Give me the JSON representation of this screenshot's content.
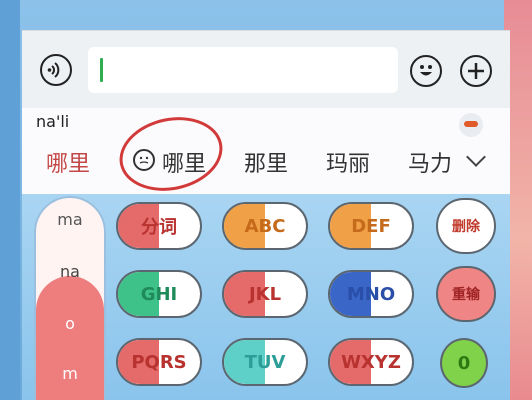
{
  "input": {
    "value": ""
  },
  "candidates": {
    "pinyin": "na'li",
    "items": [
      "哪里",
      "哪里",
      "那里",
      "玛丽",
      "马力"
    ]
  },
  "keyboard": {
    "syllables": [
      "ma",
      "na",
      "o",
      "m"
    ],
    "keys": [
      "分词",
      "ABC",
      "DEF",
      "GHI",
      "JKL",
      "MNO",
      "PQRS",
      "TUV",
      "WXYZ"
    ],
    "side": {
      "delete": "删除",
      "reenter": "重输",
      "zero": "0"
    }
  },
  "colors": {
    "red_key": "#e56a6a",
    "orange_key": "#f0a046",
    "blue_key": "#3a66c8",
    "green_key": "#3fc18a",
    "teal_key": "#5fd0c8",
    "circle": "#d23a3a"
  }
}
